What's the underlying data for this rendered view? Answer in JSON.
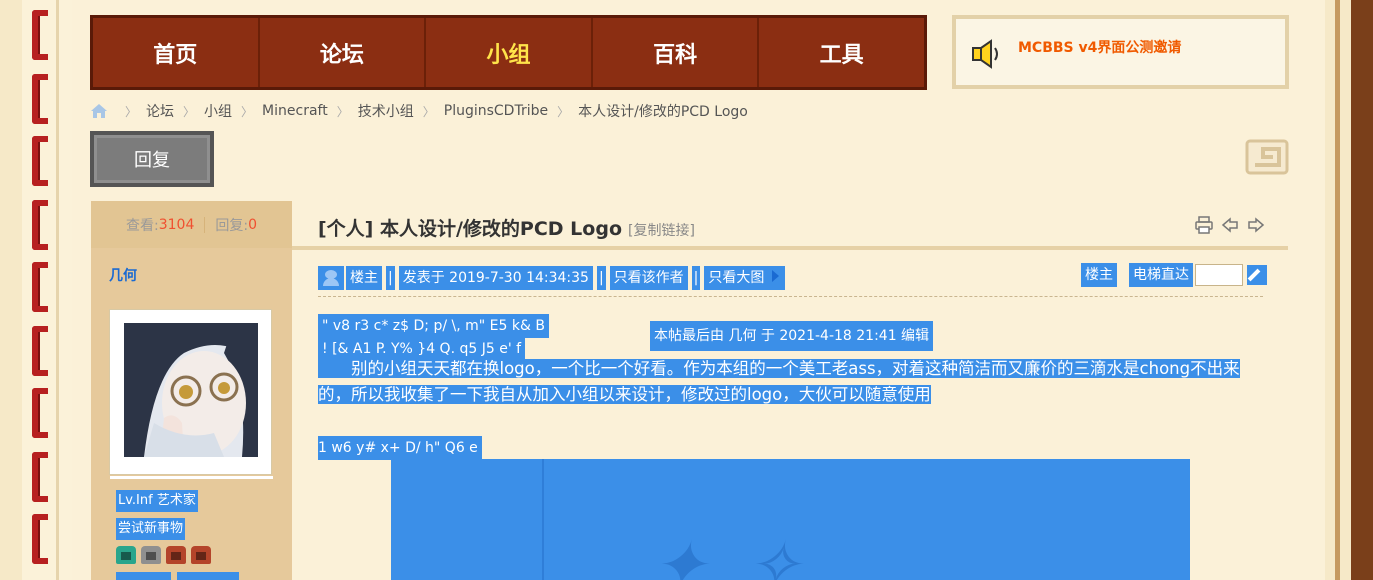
{
  "nav": {
    "items": [
      {
        "label": "首页",
        "active": false
      },
      {
        "label": "论坛",
        "active": false
      },
      {
        "label": "小组",
        "active": true
      },
      {
        "label": "百科",
        "active": false
      },
      {
        "label": "工具",
        "active": false
      }
    ]
  },
  "notice": {
    "text": "MCBBS v4界面公测邀请",
    "icon": "speaker-icon"
  },
  "breadcrumb": {
    "items": [
      "论坛",
      "小组",
      "Minecraft",
      "技术小组",
      "PluginsCDTribe",
      "本人设计/修改的PCD Logo"
    ]
  },
  "reply_button": {
    "label": "回复"
  },
  "stats": {
    "views_label": "查看:",
    "views": "3104",
    "replies_label": "回复:",
    "replies": "0"
  },
  "author": {
    "name": "几何",
    "tags": [
      "Lv.Inf 艺术家",
      "尝试新事物"
    ]
  },
  "medals": [
    {
      "color": "#2aa58c"
    },
    {
      "color": "#8f8f8f"
    },
    {
      "color": "#b4442a"
    },
    {
      "color": "#b4442a"
    }
  ],
  "post": {
    "title": "[个人] 本人设计/修改的PCD Logo",
    "copy_link": "[复制链接]",
    "meta": {
      "host": "楼主",
      "posted": "发表于 2019-7-30 14:34:35",
      "only_author": "只看该作者",
      "big_image": "只看大图"
    },
    "floor_label": "楼主",
    "jump_label": "电梯直达",
    "edited_note": "本帖最后由 几何 于 2021-4-18 21:41 编辑",
    "garble_lines": [
      "\" v8 r3 c* z$ D; p/ \\, m\" E5 k& B",
      "! [& A1 P. Y% }4 Q. q5 J5 e' f",
      "1 w6 y# x+ D/ h\" Q6 e"
    ],
    "paragraph": "　　别的小组天天都在换logo，一个比一个好看。作为本组的一个美工老ass，对着这种简洁而又廉价的三滴水是chong不出来的，所以我收集了一下我自从加入小组以来设计，修改过的logo，大伙可以随意使用"
  },
  "colors": {
    "nav_bg": "#8b2e12",
    "nav_active": "#ffe44a",
    "selection": "#3b8fe8",
    "notice_text": "#f05a00",
    "author": "#1a6ad2"
  }
}
